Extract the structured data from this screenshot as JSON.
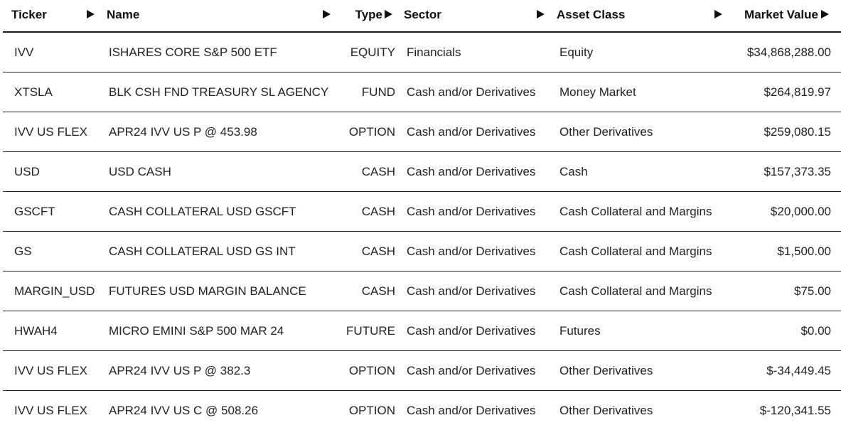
{
  "columns": {
    "ticker": "Ticker",
    "name": "Name",
    "type": "Type",
    "sector": "Sector",
    "asset_class": "Asset Class",
    "market_value": "Market Value"
  },
  "icons": {
    "sort": "triangle-right-sort-icon"
  },
  "colors": {
    "text": "#1a1a1a",
    "divider": "#222222"
  },
  "rows": [
    {
      "ticker": "IVV",
      "name": "ISHARES CORE S&P 500 ETF",
      "type": "EQUITY",
      "sector": "Financials",
      "asset_class": "Equity",
      "market_value": "$34,868,288.00"
    },
    {
      "ticker": "XTSLA",
      "name": "BLK CSH FND TREASURY SL AGENCY",
      "type": "FUND",
      "sector": "Cash and/or Derivatives",
      "asset_class": "Money Market",
      "market_value": "$264,819.97"
    },
    {
      "ticker": "IVV US FLEX",
      "name": "APR24 IVV US P @ 453.98",
      "type": "OPTION",
      "sector": "Cash and/or Derivatives",
      "asset_class": "Other Derivatives",
      "market_value": "$259,080.15"
    },
    {
      "ticker": "USD",
      "name": "USD CASH",
      "type": "CASH",
      "sector": "Cash and/or Derivatives",
      "asset_class": "Cash",
      "market_value": "$157,373.35"
    },
    {
      "ticker": "GSCFT",
      "name": "CASH COLLATERAL USD GSCFT",
      "type": "CASH",
      "sector": "Cash and/or Derivatives",
      "asset_class": "Cash Collateral and Margins",
      "market_value": "$20,000.00"
    },
    {
      "ticker": "GS",
      "name": "CASH COLLATERAL USD GS INT",
      "type": "CASH",
      "sector": "Cash and/or Derivatives",
      "asset_class": "Cash Collateral and Margins",
      "market_value": "$1,500.00"
    },
    {
      "ticker": "MARGIN_USD",
      "name": "FUTURES USD MARGIN BALANCE",
      "type": "CASH",
      "sector": "Cash and/or Derivatives",
      "asset_class": "Cash Collateral and Margins",
      "market_value": "$75.00"
    },
    {
      "ticker": "HWAH4",
      "name": "MICRO EMINI S&P 500 MAR 24",
      "type": "FUTURE",
      "sector": "Cash and/or Derivatives",
      "asset_class": "Futures",
      "market_value": "$0.00"
    },
    {
      "ticker": "IVV US FLEX",
      "name": "APR24 IVV US P @ 382.3",
      "type": "OPTION",
      "sector": "Cash and/or Derivatives",
      "asset_class": "Other Derivatives",
      "market_value": "$-34,449.45"
    },
    {
      "ticker": "IVV US FLEX",
      "name": "APR24 IVV US C @ 508.26",
      "type": "OPTION",
      "sector": "Cash and/or Derivatives",
      "asset_class": "Other Derivatives",
      "market_value": "$-120,341.55"
    }
  ]
}
